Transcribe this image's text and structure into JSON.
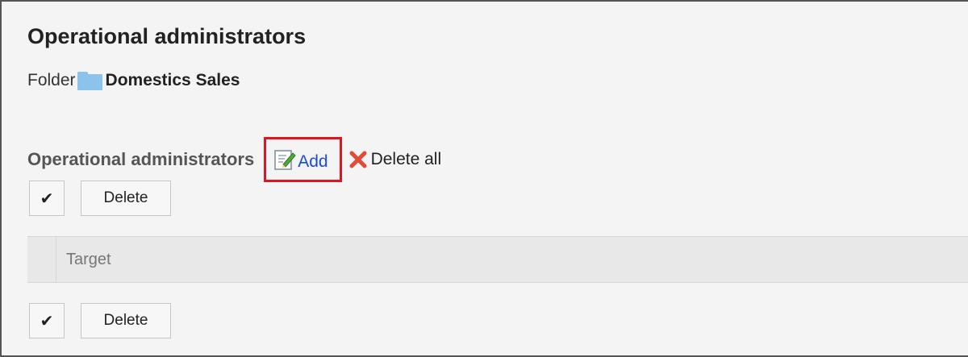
{
  "page": {
    "title": "Operational administrators",
    "folder_label": "Folder",
    "folder_name": "Domestics Sales"
  },
  "section": {
    "heading": "Operational administrators",
    "add_label": "Add",
    "delete_all_label": "Delete all"
  },
  "toolbar_top": {
    "check_all_glyph": "✔",
    "delete_label": "Delete"
  },
  "table": {
    "columns": [
      "Target"
    ]
  },
  "toolbar_bottom": {
    "check_all_glyph": "✔",
    "delete_label": "Delete"
  },
  "colors": {
    "highlight_border": "#e0141e",
    "link": "#1a4ad6",
    "folder_icon": "#8cc3ec"
  },
  "icons": {
    "folder": "folder-icon",
    "add": "edit-icon",
    "delete_all": "delete-x-icon"
  }
}
